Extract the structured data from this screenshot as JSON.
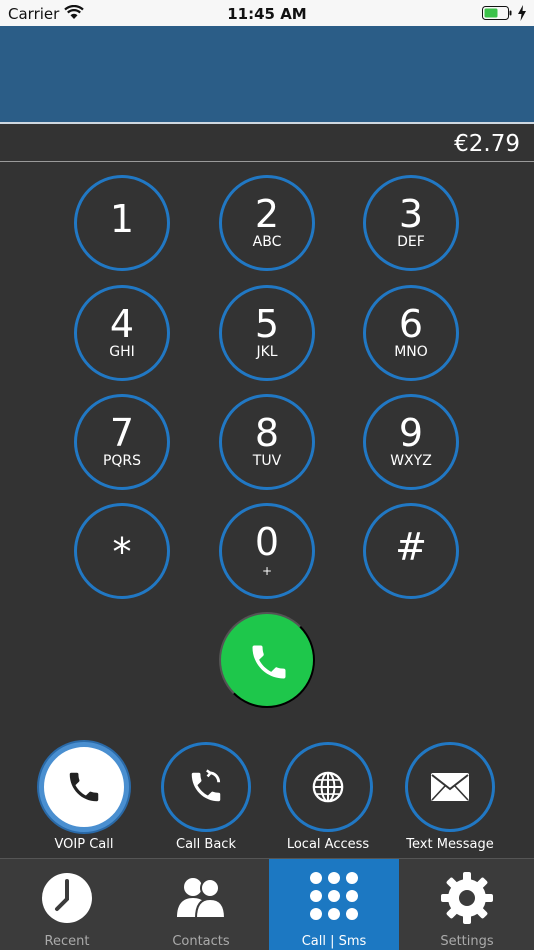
{
  "status_bar": {
    "carrier": "Carrier",
    "time": "11:45 AM"
  },
  "balance": "€2.79",
  "keypad": [
    {
      "digit": "1",
      "letters": ""
    },
    {
      "digit": "2",
      "letters": "ABC"
    },
    {
      "digit": "3",
      "letters": "DEF"
    },
    {
      "digit": "4",
      "letters": "GHI"
    },
    {
      "digit": "5",
      "letters": "JKL"
    },
    {
      "digit": "6",
      "letters": "MNO"
    },
    {
      "digit": "7",
      "letters": "PQRS"
    },
    {
      "digit": "8",
      "letters": "TUV"
    },
    {
      "digit": "9",
      "letters": "WXYZ"
    },
    {
      "digit": "*",
      "letters": ""
    },
    {
      "digit": "0",
      "letters": "+"
    },
    {
      "digit": "#",
      "letters": ""
    }
  ],
  "call_modes": [
    {
      "label": "VOIP Call",
      "icon": "phone-icon",
      "active": true
    },
    {
      "label": "Call Back",
      "icon": "callback-icon",
      "active": false
    },
    {
      "label": "Local Access",
      "icon": "globe-icon",
      "active": false
    },
    {
      "label": "Text Message",
      "icon": "envelope-icon",
      "active": false
    }
  ],
  "tabs": [
    {
      "label": "Recent",
      "icon": "clock-icon",
      "active": false
    },
    {
      "label": "Contacts",
      "icon": "contacts-icon",
      "active": false
    },
    {
      "label": "Call | Sms",
      "icon": "keypad-icon",
      "active": true
    },
    {
      "label": "Settings",
      "icon": "gear-icon",
      "active": false
    }
  ],
  "colors": {
    "accent": "#2178c4",
    "call_green": "#1ec74b",
    "header": "#2b5d87",
    "background": "#333333"
  }
}
